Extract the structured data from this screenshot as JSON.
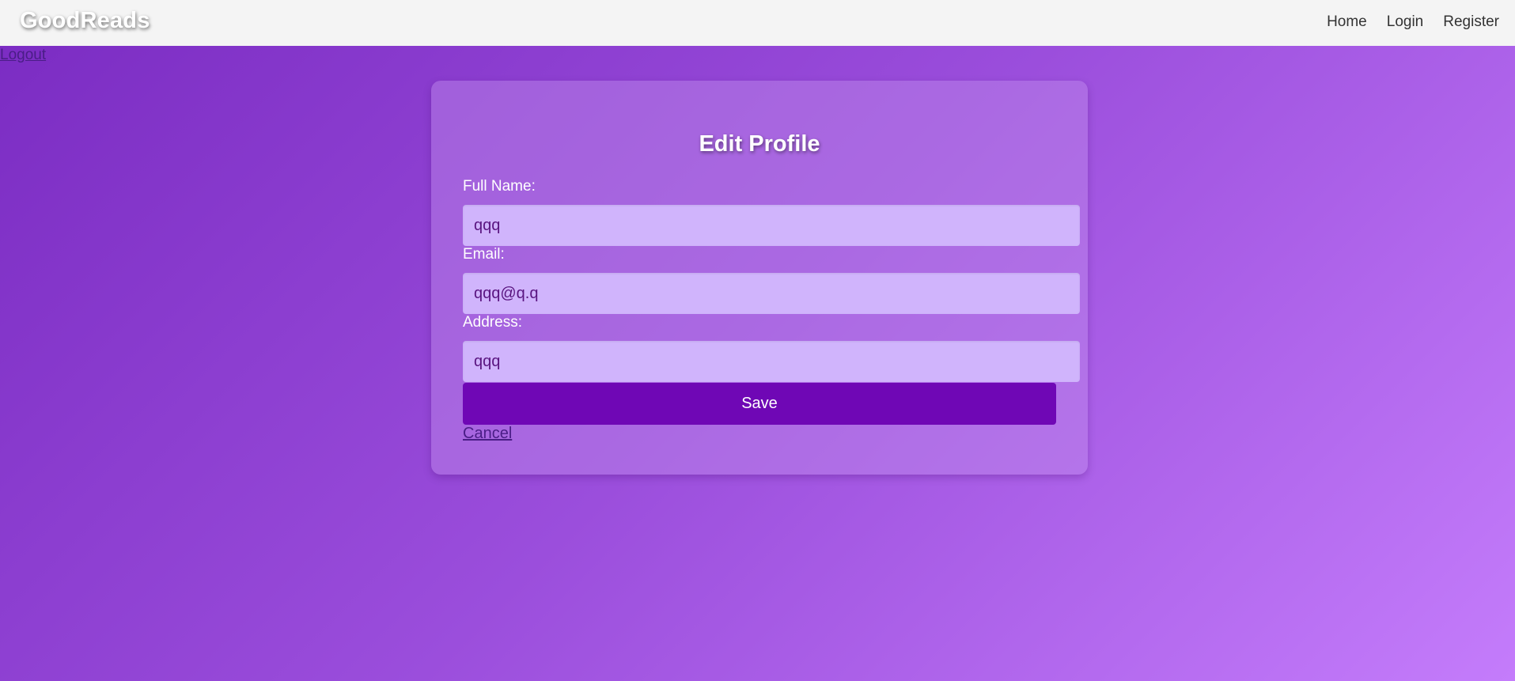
{
  "navbar": {
    "brand": "GoodReads",
    "links": [
      "Home",
      "Login",
      "Register"
    ]
  },
  "logout_label": "Logout",
  "form": {
    "title": "Edit Profile",
    "fields": [
      {
        "label": "Full Name:",
        "value": "qqq"
      },
      {
        "label": "Email:",
        "value": "qqq@q.q"
      },
      {
        "label": "Address:",
        "value": "qqq"
      }
    ],
    "save_label": "Save",
    "cancel_label": "Cancel"
  },
  "colors": {
    "navbar_bg": "#f4f4f4",
    "gradient_start": "#7a2bc2",
    "gradient_end": "#c47cfb",
    "input_bg": "#d0b4fc",
    "save_button_bg": "#6f07b5"
  }
}
